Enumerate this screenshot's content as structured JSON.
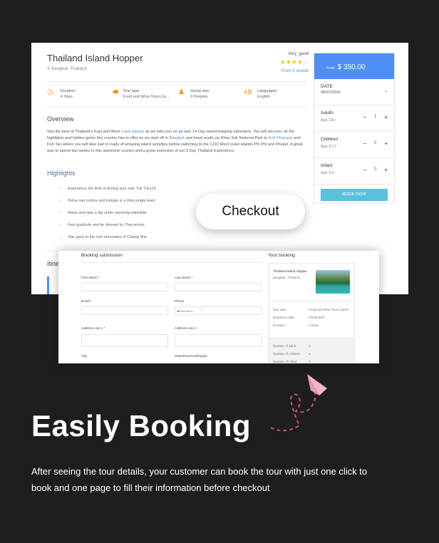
{
  "tour": {
    "title": "Thailand Island Hopper",
    "location": "Bangkok, Thailand",
    "rating_label": "Very_good",
    "rating": 4,
    "rating_max": 5,
    "review_link": "From 1 review",
    "features": [
      {
        "icon": "clock-icon",
        "label": "Duration",
        "value": "4 Days"
      },
      {
        "icon": "footprints-icon",
        "label": "Tour type",
        "value": "Food and Wine Tours,Fa..."
      },
      {
        "icon": "person-icon",
        "label": "Group size",
        "value": "3 Peoples"
      },
      {
        "icon": "language-icon",
        "label": "Languages",
        "value": "English"
      }
    ],
    "overview_title": "Overview",
    "overview": [
      "See the best of Thailand's East and West ",
      "coast islands",
      " as we take you on an epic 14-Day island-hopping adventure. You will discover all the highlights and hidden gems this country has to offer as we start off in ",
      "Bangkok",
      " and head south via Khao Sok National Park to ",
      "Koh Phangan",
      " and Koh Tao where you will take part in loads of amazing island activities before switching to the 1222 West coast islands Phi Phi and Phuket. A great way to spend two weeks in this awesome country and a great extension of our 8 Day Thailand Experience."
    ],
    "highlights_title": "Highlights",
    "highlights": [
      "Experience the thrill of driving your own Tuk Tuk123",
      "Delve into culture and indulge in a tribe jungle feast",
      "Relax and take a dip under stunning waterfalls",
      "Feel gratitude and be blessed by Thai monks",
      "Star gaze in the lush mountains of Chiang Mai"
    ],
    "itinerary_title": "Itine"
  },
  "sidebar": {
    "from": "From",
    "price": "$ 350.00",
    "date_label": "DATE",
    "date": "08/07/2020",
    "guests": [
      {
        "label": "Adults",
        "age": "Age 18+",
        "count": "1"
      },
      {
        "label": "Children",
        "age": "Age 6-17",
        "count": "0"
      },
      {
        "label": "Infant",
        "age": "Age 0-5",
        "count": "0"
      }
    ],
    "minus": "−",
    "plus": "+",
    "book": "BOOK NOW"
  },
  "checkout": "Checkout",
  "form": {
    "title": "Booking submission",
    "first": "First Name *",
    "last": "Last Name *",
    "email": "Email *",
    "phone": "Phone",
    "country": "Vietnam",
    "addr1": "Address Line 1 *",
    "addr2": "Address Line 2",
    "city": "City",
    "state": "State/Province/Region"
  },
  "your_booking": {
    "title": "Your booking",
    "tour": "Thailand Island Hopper",
    "location": "Bangkok, Thailand",
    "details": [
      [
        "Tour type",
        "Food and Wine Tours,Famil..."
      ],
      [
        "Departure date",
        "07/08/2020"
      ],
      [
        "Duration",
        "4 Days"
      ]
    ],
    "counts": [
      [
        "Number of adult",
        "1"
      ],
      [
        "Number of children",
        "0"
      ],
      [
        "Number of infant",
        "0"
      ]
    ]
  },
  "headline": "Easily Booking",
  "description": "After seeing the tour details, your customer can book the tour with just one click to book and one page to fill their information before checkout",
  "colors": {
    "accent": "#4d8ff5",
    "orange": "#f7931e",
    "book_button": "#5bc0de",
    "background": "#1e1e1e"
  }
}
